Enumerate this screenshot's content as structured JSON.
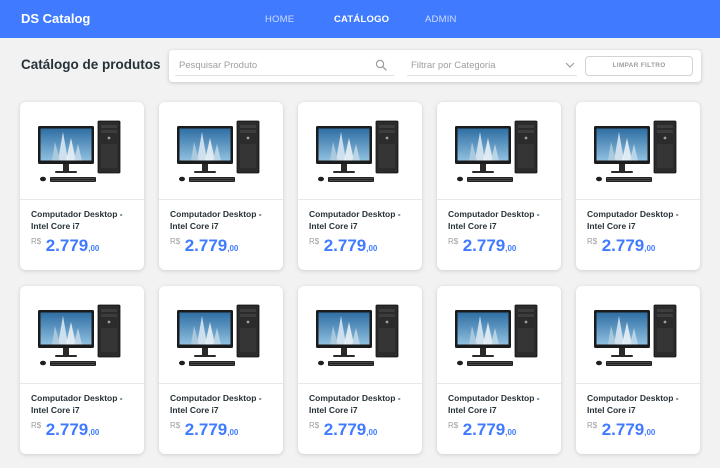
{
  "navbar": {
    "brand": "DS Catalog",
    "links": [
      {
        "label": "HOME",
        "active": false
      },
      {
        "label": "CATÁLOGO",
        "active": true
      },
      {
        "label": "ADMIN",
        "active": false
      }
    ]
  },
  "page_title": "Catálogo de produtos",
  "filters": {
    "search_placeholder": "Pesquisar Produto",
    "category_placeholder": "Filtrar por Categoria",
    "clear_button": "LIMPAR FILTRO"
  },
  "products": [
    {
      "name": "Computador Desktop - Intel Core i7",
      "currency": "R$",
      "price_int": "2.779",
      "price_dec": ",00"
    },
    {
      "name": "Computador Desktop - Intel Core i7",
      "currency": "R$",
      "price_int": "2.779",
      "price_dec": ",00"
    },
    {
      "name": "Computador Desktop - Intel Core i7",
      "currency": "R$",
      "price_int": "2.779",
      "price_dec": ",00"
    },
    {
      "name": "Computador Desktop - Intel Core i7",
      "currency": "R$",
      "price_int": "2.779",
      "price_dec": ",00"
    },
    {
      "name": "Computador Desktop - Intel Core i7",
      "currency": "R$",
      "price_int": "2.779",
      "price_dec": ",00"
    },
    {
      "name": "Computador Desktop - Intel Core i7",
      "currency": "R$",
      "price_int": "2.779",
      "price_dec": ",00"
    },
    {
      "name": "Computador Desktop - Intel Core i7",
      "currency": "R$",
      "price_int": "2.779",
      "price_dec": ",00"
    },
    {
      "name": "Computador Desktop - Intel Core i7",
      "currency": "R$",
      "price_int": "2.779",
      "price_dec": ",00"
    },
    {
      "name": "Computador Desktop - Intel Core i7",
      "currency": "R$",
      "price_int": "2.779",
      "price_dec": ",00"
    },
    {
      "name": "Computador Desktop - Intel Core i7",
      "currency": "R$",
      "price_int": "2.779",
      "price_dec": ",00"
    }
  ],
  "colors": {
    "primary": "#407bff",
    "background": "#f2f2f2",
    "text": "#263238",
    "muted": "#9e9e9e"
  },
  "icons": {
    "search": "search-icon",
    "chevron": "chevron-down-icon",
    "product_image": "desktop-computer-image"
  }
}
